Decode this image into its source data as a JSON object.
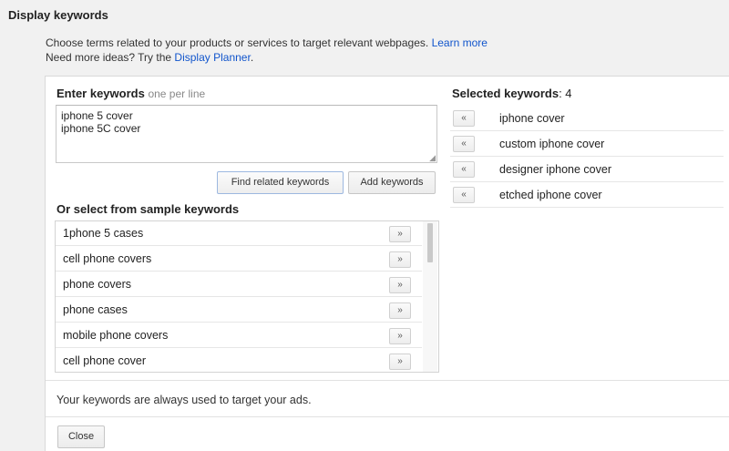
{
  "dialog": {
    "title": "Display keywords",
    "description": "Choose terms related to your products or services to target relevant webpages.",
    "learn_more": "Learn more",
    "ideas_prefix": "Need more ideas? Try the",
    "display_planner": "Display Planner",
    "ideas_suffix": "."
  },
  "enter": {
    "label": "Enter keywords",
    "hint": "one per line",
    "value": "iphone 5 cover\niphone 5C cover"
  },
  "buttons": {
    "find_related": "Find related keywords",
    "add_keywords": "Add keywords",
    "close": "Close",
    "add_arrow": "»",
    "remove_arrow": "«"
  },
  "sample": {
    "label": "Or select from sample keywords",
    "items": [
      "1phone 5 cases",
      "cell phone covers",
      "phone covers",
      "phone cases",
      "mobile phone covers",
      "cell phone cover"
    ]
  },
  "selected": {
    "label": "Selected keywords",
    "count_text": ": 4",
    "items": [
      "iphone cover",
      "custom iphone cover",
      "designer iphone cover",
      "etched iphone cover"
    ]
  },
  "footer": {
    "note": "Your keywords are always used to target your ads."
  }
}
